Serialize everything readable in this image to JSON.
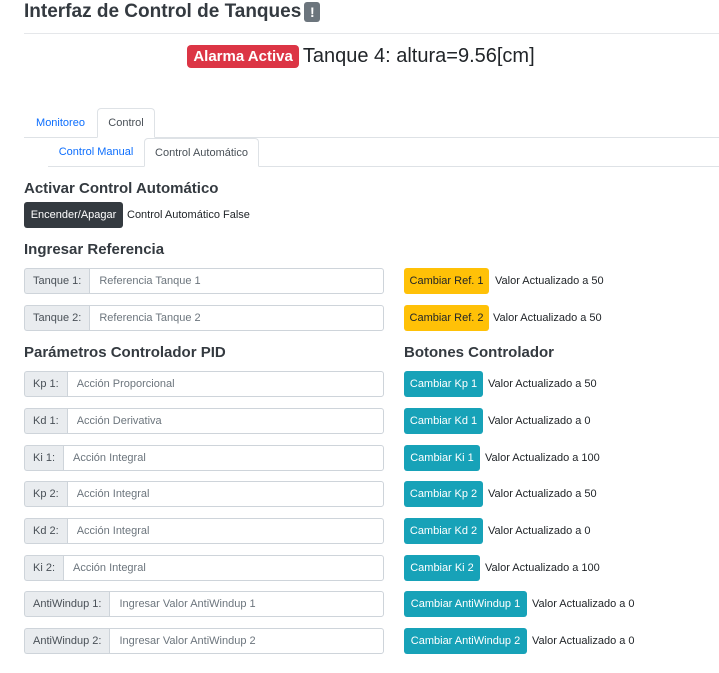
{
  "header": {
    "title": "Interfaz de Control de Tanques",
    "info_badge": "!"
  },
  "status": {
    "alarm_label": "Alarma Activa",
    "tank_text": "Tanque 4: altura=9.56[cm]"
  },
  "main_tabs": [
    {
      "label": "Monitoreo",
      "active": false
    },
    {
      "label": "Control",
      "active": true
    }
  ],
  "sub_tabs": [
    {
      "label": "Control Manual",
      "active": false
    },
    {
      "label": "Control Automático",
      "active": true
    }
  ],
  "auto": {
    "heading": "Activar Control Automático",
    "toggle_label": "Encender/Apagar",
    "status": "Control Automático False"
  },
  "reference": {
    "heading": "Ingresar Referencia",
    "rows": [
      {
        "label": "Tanque 1:",
        "placeholder": "Referencia Tanque 1",
        "button": "Cambiar Ref. 1",
        "value": "Valor Actualizado a 50"
      },
      {
        "label": "Tanque 2:",
        "placeholder": "Referencia Tanque 2",
        "button": "Cambiar Ref. 2",
        "value": "Valor Actualizado a 50"
      }
    ]
  },
  "pid": {
    "heading": "Parámetros Controlador PID",
    "buttons_heading": "Botones Controlador",
    "rows": [
      {
        "label": "Kp 1:",
        "placeholder": "Acción Proporcional",
        "button": "Cambiar Kp 1",
        "value": "Valor Actualizado a 50"
      },
      {
        "label": "Kd 1:",
        "placeholder": "Acción Derivativa",
        "button": "Cambiar Kd 1",
        "value": "Valor Actualizado a 0"
      },
      {
        "label": "Ki 1:",
        "placeholder": "Acción Integral",
        "button": "Cambiar Ki 1",
        "value": "Valor Actualizado a 100"
      },
      {
        "label": "Kp 2:",
        "placeholder": "Acción Integral",
        "button": "Cambiar Kp 2",
        "value": "Valor Actualizado a 50"
      },
      {
        "label": "Kd 2:",
        "placeholder": "Acción Integral",
        "button": "Cambiar Kd 2",
        "value": "Valor Actualizado a 0"
      },
      {
        "label": "Ki 2:",
        "placeholder": "Acción Integral",
        "button": "Cambiar Ki 2",
        "value": "Valor Actualizado a 100"
      },
      {
        "label": "AntiWindup 1:",
        "placeholder": "Ingresar Valor AntiWindup 1",
        "button": "Cambiar AntiWindup 1",
        "value": "Valor Actualizado a 0"
      },
      {
        "label": "AntiWindup 2:",
        "placeholder": "Ingresar Valor AntiWindup 2",
        "button": "Cambiar AntiWindup 2",
        "value": "Valor Actualizado a 0"
      }
    ]
  },
  "colors": {
    "alarm": "#dc3545",
    "warning_button": "#ffc107",
    "info_button": "#17a2b8",
    "dark_button": "#343a40",
    "link": "#0d6efd"
  }
}
